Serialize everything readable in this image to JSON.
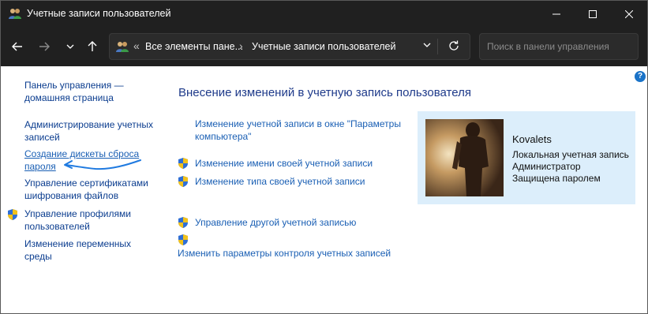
{
  "window": {
    "title": "Учетные записи пользователей"
  },
  "address_bar": {
    "separator": "«",
    "crumb1": "Все элементы пане...",
    "separator2": "›",
    "crumb2": "Учетные записи пользователей"
  },
  "search": {
    "placeholder": "Поиск в панели управления"
  },
  "sidebar": {
    "home": [
      "Панель управления —",
      "домашняя страница"
    ],
    "items": [
      {
        "lines": [
          "Администрирование учетных",
          "записей"
        ]
      },
      {
        "lines": [
          "Создание дискеты сброса",
          "пароля"
        ]
      },
      {
        "lines": [
          "Управление сертификатами",
          "шифрования файлов"
        ]
      },
      {
        "lines": [
          "Управление профилями",
          "пользователей"
        ]
      },
      {
        "lines": [
          "Изменение переменных",
          "среды"
        ]
      }
    ]
  },
  "main": {
    "heading": "Внесение изменений в учетную запись пользователя",
    "link_settings": [
      "Изменение учетной записи в окне \"Параметры",
      "компьютера\""
    ],
    "link_rename": "Изменение имени своей учетной записи",
    "link_type": "Изменение типа своей учетной записи",
    "link_other": "Управление другой учетной записью",
    "link_uac": "Изменить параметры контроля учетных записей"
  },
  "account": {
    "name": "Kovalets",
    "details": [
      "Локальная учетная запись",
      "Администратор",
      "Защищена паролем"
    ]
  },
  "help_label": "?",
  "colors": {
    "titlebar": "#202020",
    "card": "#dceefb",
    "link": "#0b3d8f",
    "accent_arrow": "#1f7ae0"
  }
}
